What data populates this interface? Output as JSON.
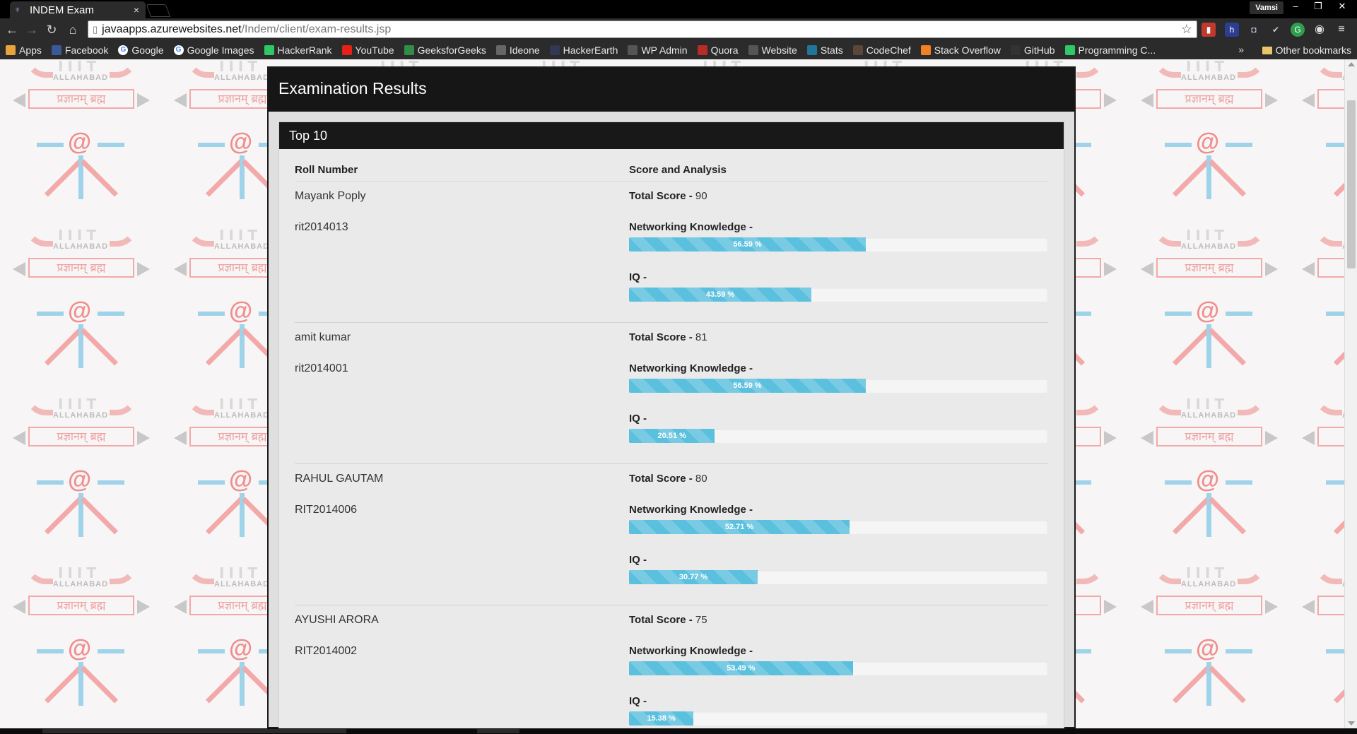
{
  "browser": {
    "tab_title": "INDEM Exam",
    "tab_close": "×",
    "profile_name": "Vamsi",
    "url_domain": "javaapps.azurewebsites.net",
    "url_path": "/Indem/client/exam-results.jsp",
    "bookmarks": [
      {
        "label": "Apps",
        "icon": "apps-grid-icon",
        "color": "#e8a33d"
      },
      {
        "label": "Facebook",
        "icon": "facebook-icon",
        "color": "#3b5998"
      },
      {
        "label": "Google",
        "icon": "google-icon",
        "color": "#ffffff"
      },
      {
        "label": "Google Images",
        "icon": "google-icon",
        "color": "#ffffff"
      },
      {
        "label": "HackerRank",
        "icon": "hackerrank-icon",
        "color": "#2ec866"
      },
      {
        "label": "YouTube",
        "icon": "youtube-icon",
        "color": "#e62117"
      },
      {
        "label": "GeeksforGeeks",
        "icon": "geeksforgeeks-icon",
        "color": "#2f8d46"
      },
      {
        "label": "Ideone",
        "icon": "ideone-icon",
        "color": "#666666"
      },
      {
        "label": "HackerEarth",
        "icon": "hackerearth-icon",
        "color": "#323754"
      },
      {
        "label": "WP Admin",
        "icon": "wp-admin-icon",
        "color": "#555555"
      },
      {
        "label": "Quora",
        "icon": "quora-icon",
        "color": "#b92b27"
      },
      {
        "label": "Website",
        "icon": "website-icon",
        "color": "#555555"
      },
      {
        "label": "Stats",
        "icon": "wordpress-icon",
        "color": "#21759b"
      },
      {
        "label": "CodeChef",
        "icon": "codechef-icon",
        "color": "#5b4638"
      },
      {
        "label": "Stack Overflow",
        "icon": "stackoverflow-icon",
        "color": "#f48024"
      },
      {
        "label": "GitHub",
        "icon": "github-icon",
        "color": "#333333"
      },
      {
        "label": "Programming C...",
        "icon": "hackerrank-icon",
        "color": "#2ec866"
      }
    ],
    "bookmarks_more": "»",
    "other_bookmarks": "Other bookmarks"
  },
  "background": {
    "logo_iiit": "IIIT",
    "logo_allahabad": "ALLAHABAD",
    "logo_motto": "प्रज्ञानम् ब्रह्म",
    "logo_at": "@"
  },
  "page": {
    "title": "Examination Results",
    "section_title": "Top 10",
    "col_roll": "Roll Number",
    "col_score": "Score and Analysis",
    "total_score_label": "Total Score - ",
    "networking_label": "Networking Knowledge -",
    "iq_label": "IQ -"
  },
  "results": [
    {
      "name": "Mayank Poply",
      "roll": "rit2014013",
      "total": "90",
      "networking": 56.59,
      "networking_text": "56.59 %",
      "iq": 43.59,
      "iq_text": "43.59 %"
    },
    {
      "name": "amit kumar",
      "roll": "rit2014001",
      "total": "81",
      "networking": 56.59,
      "networking_text": "56.59 %",
      "iq": 20.51,
      "iq_text": "20.51 %"
    },
    {
      "name": "RAHUL GAUTAM",
      "roll": "RIT2014006",
      "total": "80",
      "networking": 52.71,
      "networking_text": "52.71 %",
      "iq": 30.77,
      "iq_text": "30.77 %"
    },
    {
      "name": "AYUSHI ARORA",
      "roll": "RIT2014002",
      "total": "75",
      "networking": 53.49,
      "networking_text": "53.49 %",
      "iq": 15.38,
      "iq_text": "15.38 %"
    }
  ],
  "colors": {
    "progress_fill": "#5bc0de",
    "header_bg": "#161616"
  }
}
